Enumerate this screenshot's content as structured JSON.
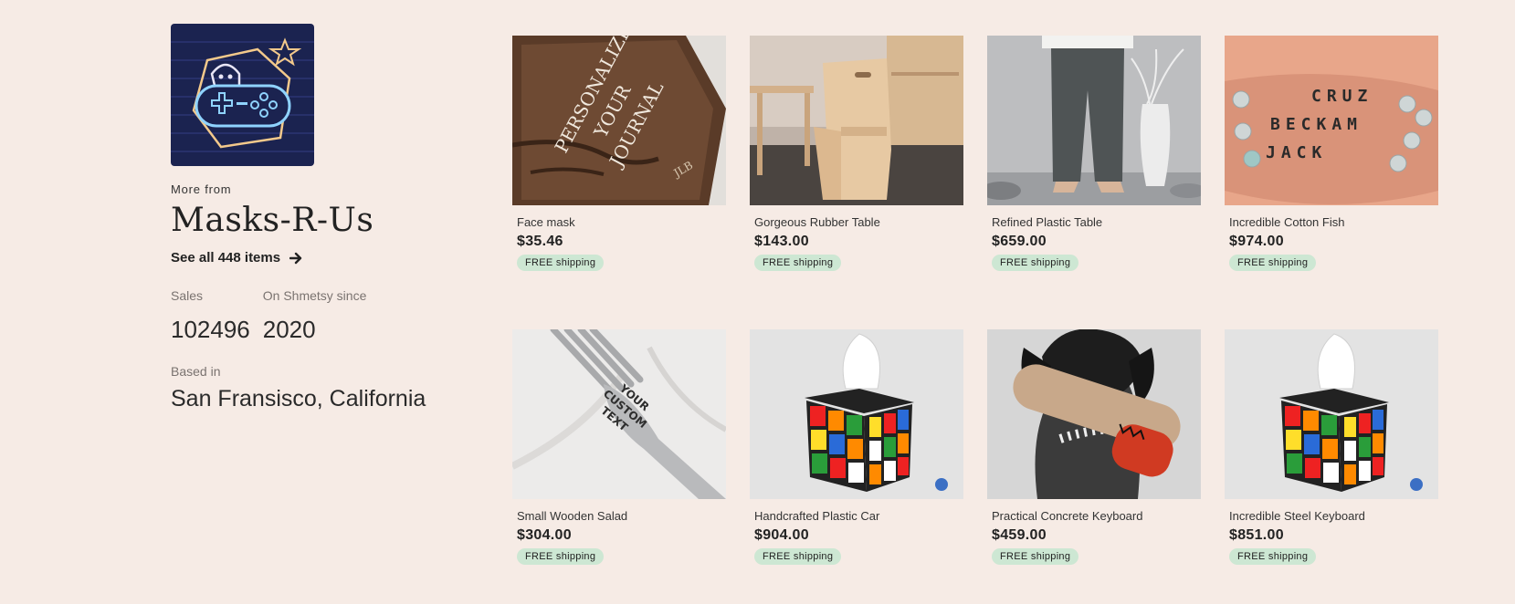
{
  "shop": {
    "logo_icon": "neon-gamepad-ghost-icon",
    "more_from": "More from",
    "name": "Masks-R-Us",
    "see_all": "See all 448 items",
    "sales_label": "Sales",
    "sales_value": "102496",
    "since_label": "On Shmetsy since",
    "since_value": "2020",
    "based_label": "Based in",
    "based_value": "San Fransisco, California"
  },
  "colors": {
    "background": "#f6ebe5",
    "badge": "#cde7d3"
  },
  "products": [
    {
      "title": "Face mask",
      "price": "$35.46",
      "badge": "FREE shipping",
      "image": "leather-journal-image"
    },
    {
      "title": "Gorgeous Rubber Table",
      "price": "$143.00",
      "badge": "FREE shipping",
      "image": "wooden-chair-image"
    },
    {
      "title": "Refined Plastic Table",
      "price": "$659.00",
      "badge": "FREE shipping",
      "image": "linen-pants-image"
    },
    {
      "title": "Incredible Cotton Fish",
      "price": "$974.00",
      "badge": "FREE shipping",
      "image": "name-bracelets-image"
    },
    {
      "title": "Small Wooden Salad",
      "price": "$304.00",
      "badge": "FREE shipping",
      "image": "engraved-fork-image"
    },
    {
      "title": "Handcrafted Plastic Car",
      "price": "$904.00",
      "badge": "FREE shipping",
      "image": "rubik-tissue-box-image"
    },
    {
      "title": "Practical Concrete Keyboard",
      "price": "$459.00",
      "badge": "FREE shipping",
      "image": "dog-toy-image"
    },
    {
      "title": "Incredible Steel Keyboard",
      "price": "$851.00",
      "badge": "FREE shipping",
      "image": "rubik-tissue-box-image"
    }
  ],
  "image_text": {
    "journal": [
      "PERSONALIZE",
      "YOUR",
      "JOURNAL"
    ],
    "journal_initials": "JLB",
    "fork": [
      "YOUR",
      "CUSTOM",
      "TEXT"
    ],
    "bracelets": [
      "CRUZ",
      "BECKAM",
      "JACK"
    ]
  }
}
